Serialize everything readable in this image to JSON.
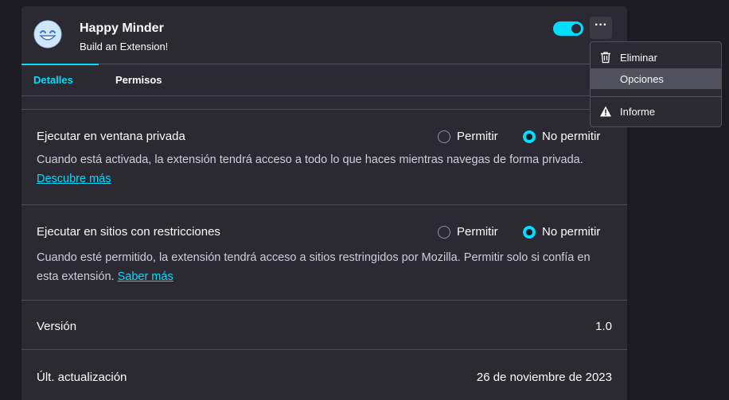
{
  "extension": {
    "name": "Happy Minder",
    "description": "Build an Extension!",
    "enabled": true,
    "more_label": "···"
  },
  "tabs": [
    {
      "label": "Detalles",
      "active": true
    },
    {
      "label": "Permisos",
      "active": false
    }
  ],
  "private_window": {
    "title": "Ejecutar en ventana privada",
    "description": "Cuando está activada, la extensión tendrá acceso a todo lo que haces mientras navegas de forma privada.",
    "link": "Descubre más",
    "options": [
      {
        "label": "Permitir",
        "selected": false
      },
      {
        "label": "No permitir",
        "selected": true
      }
    ]
  },
  "restricted_sites": {
    "title": "Ejecutar en sitios con restricciones",
    "description": "Cuando esté permitido, la extensión tendrá acceso a sitios restringidos por Mozilla. Permitir solo si confía en esta extensión.",
    "link": "Saber más",
    "options": [
      {
        "label": "Permitir",
        "selected": false
      },
      {
        "label": "No permitir",
        "selected": true
      }
    ]
  },
  "info": {
    "version_label": "Versión",
    "version_value": "1.0",
    "updated_label": "Últ. actualización",
    "updated_value": "26 de noviembre de 2023"
  },
  "menu": {
    "items": [
      {
        "label": "Eliminar",
        "icon": "trash-icon"
      },
      {
        "label": "Opciones",
        "icon": ""
      },
      {
        "label": "Informe",
        "icon": "warning-icon"
      }
    ],
    "hovered": "Opciones"
  },
  "colors": {
    "accent": "#00ddff",
    "background": "#1c1b22",
    "card": "#2b2a33"
  }
}
